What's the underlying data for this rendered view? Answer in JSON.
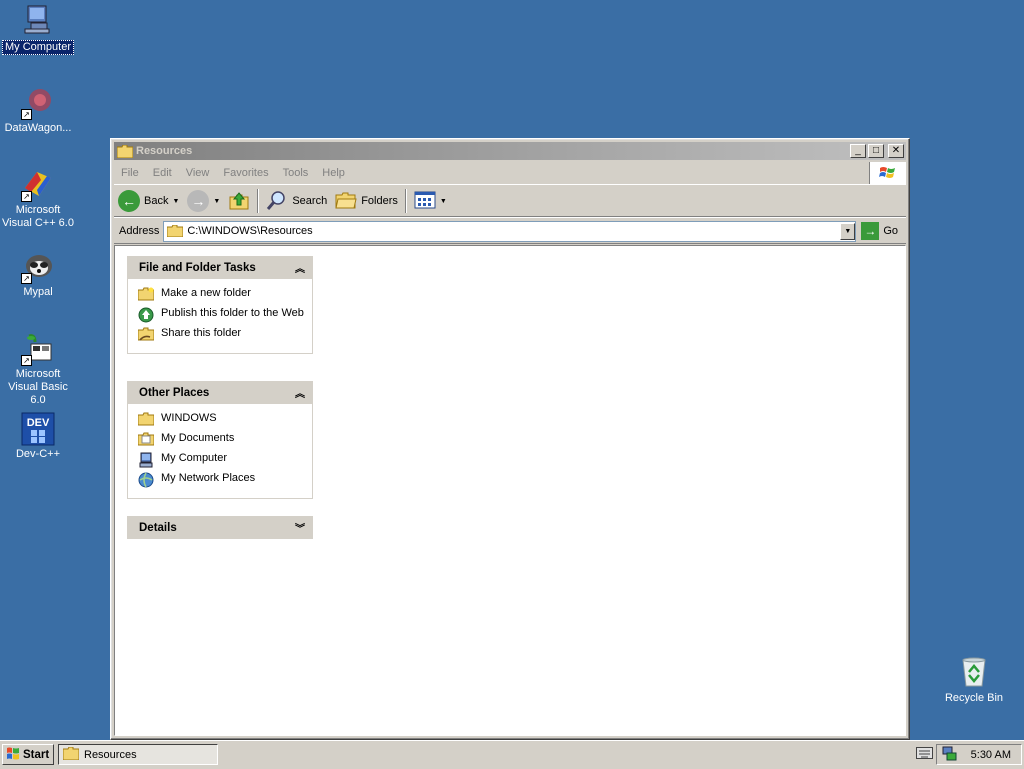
{
  "desktop": {
    "icons": [
      {
        "label": "My Computer",
        "icon": "my-computer-icon"
      },
      {
        "label": "DataWagon...",
        "icon": "datawagon-icon"
      },
      {
        "label": "Microsoft Visual C++ 6.0",
        "icon": "visual-cpp-icon"
      },
      {
        "label": "Mypal",
        "icon": "mypal-icon"
      },
      {
        "label": "Microsoft Visual Basic 6.0",
        "icon": "visual-basic-icon"
      },
      {
        "label": "Dev-C++",
        "icon": "dev-cpp-icon"
      },
      {
        "label": "Recycle Bin",
        "icon": "recycle-bin-icon"
      }
    ],
    "background_color": "#3a6ea5"
  },
  "window": {
    "title": "Resources",
    "menu": [
      "File",
      "Edit",
      "View",
      "Favorites",
      "Tools",
      "Help"
    ],
    "toolbar": {
      "back_label": "Back",
      "search_label": "Search",
      "folders_label": "Folders"
    },
    "address": {
      "label": "Address",
      "value": "C:\\WINDOWS\\Resources",
      "go_label": "Go"
    },
    "panes": {
      "file_tasks": {
        "title": "File and Folder Tasks",
        "items": [
          "Make a new folder",
          "Publish this folder to the Web",
          "Share this folder"
        ]
      },
      "other_places": {
        "title": "Other Places",
        "items": [
          "WINDOWS",
          "My Documents",
          "My Computer",
          "My Network Places"
        ]
      },
      "details": {
        "title": "Details"
      }
    }
  },
  "taskbar": {
    "start_label": "Start",
    "task_label": "Resources",
    "clock": "5:30 AM"
  }
}
